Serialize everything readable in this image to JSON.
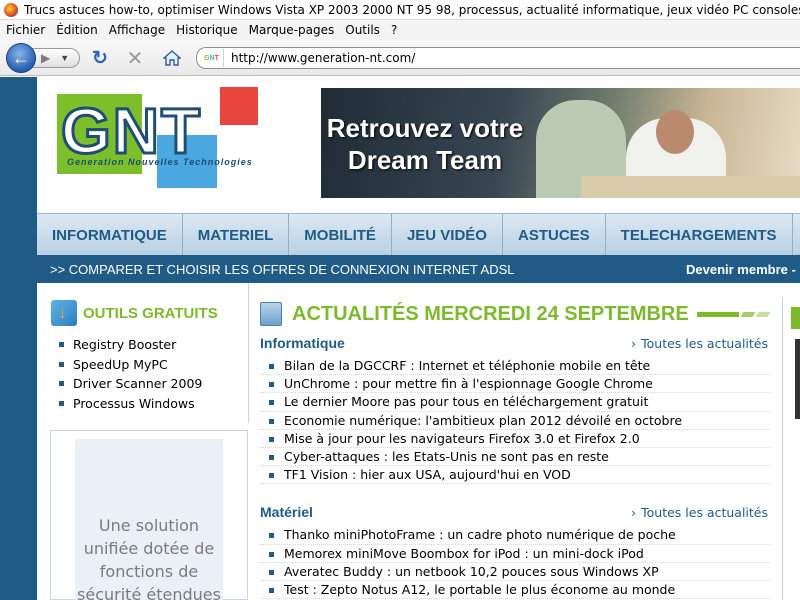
{
  "window": {
    "title": "Trucs astuces how-to, optimiser Windows Vista XP 2003 2000 NT 95 98, processus, actualité informatique, jeux vidéo PC consoles, dossier, test, com"
  },
  "menubar": {
    "items": [
      "Fichier",
      "Édition",
      "Affichage",
      "Historique",
      "Marque-pages",
      "Outils",
      "?"
    ]
  },
  "toolbar": {
    "url": "http://www.generation-nt.com/",
    "site_icon": "GNT"
  },
  "site": {
    "logo_text": "GNT",
    "logo_tagline": "Generation Nouvelles Technologies",
    "banner_line1": "Retrouvez votre",
    "banner_line2": "Dream Team",
    "nav": [
      "INFORMATIQUE",
      "MATERIEL",
      "MOBILITÉ",
      "JEU VIDÉO",
      "ASTUCES",
      "TELECHARGEMENTS"
    ],
    "subnav_left": ">> COMPARER ET CHOISIR LES OFFRES DE CONNEXION INTERNET ADSL",
    "subnav_right": "Devenir membre -"
  },
  "sidebar": {
    "title": "OUTILS GRATUITS",
    "tools": [
      "Registry Booster",
      "SpeedUp MyPC",
      "Driver Scanner 2009",
      "Processus Windows"
    ],
    "ad_text": "Une solution unifiée dotée de fonctions de sécurité étendues"
  },
  "news": {
    "heading": "ACTUALITÉS MERCREDI 24 SEPTEMBRE",
    "sections": [
      {
        "category": "Informatique",
        "all_link": "Toutes les actualités",
        "items": [
          "Bilan de la DGCCRF : Internet et téléphonie mobile en tête",
          "UnChrome : pour mettre fin à l'espionnage Google Chrome",
          "Le dernier Moore pas pour tous en téléchargement gratuit",
          "Economie numérique: l'ambitieux plan 2012 dévoilé en octobre",
          "Mise à jour pour les navigateurs Firefox 3.0 et Firefox 2.0",
          "Cyber-attaques : les Etats-Unis ne sont pas en reste",
          "TF1 Vision : hier aux USA, aujourd'hui en VOD"
        ]
      },
      {
        "category": "Matériel",
        "all_link": "Toutes les actualités",
        "items": [
          "Thanko miniPhotoFrame : un cadre photo numérique de poche",
          "Memorex miniMove Boombox for iPod : un mini-dock iPod",
          "Averatec Buddy : un netbook 10,2 pouces sous Windows XP",
          "Test : Zepto Notus A12, le portable le plus économe au monde"
        ]
      }
    ]
  },
  "colors": {
    "brand_blue": "#1f5b86",
    "brand_green": "#7db92c",
    "logo_red": "#e8453c",
    "logo_lightblue": "#4aa7df"
  }
}
